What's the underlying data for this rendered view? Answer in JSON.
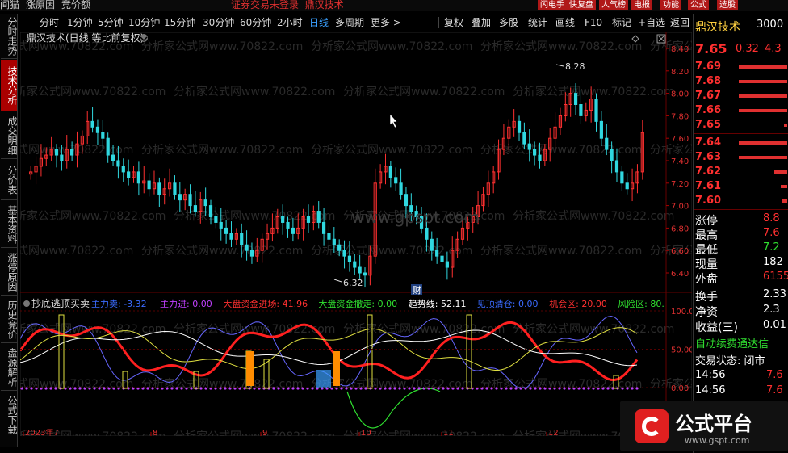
{
  "topbar": {
    "menu": [
      "间猫",
      "涨原因",
      "竞价额"
    ],
    "warning": "证券交易未登录",
    "stock": "鼎汉技术",
    "buttons": [
      "闪电手",
      "快复盘",
      "人气榜",
      "电报",
      "功能",
      "公式",
      "选股"
    ]
  },
  "periodbar": {
    "items": [
      "分时",
      "1分钟",
      "5分钟",
      "10分钟",
      "15分钟",
      "30分钟",
      "60分钟",
      "2小时",
      "日线",
      "多周期",
      "更多 >"
    ],
    "active": "日线",
    "tools": [
      "复权",
      "叠加",
      "多股",
      "统计",
      "画线",
      "F10",
      "标记",
      "+自选",
      "返回"
    ]
  },
  "sidetabs": [
    "分时走势",
    "技术分析",
    "成交明细",
    "分价表",
    "基本资料",
    "涨停原因",
    "历史竞价",
    "盘源解析",
    "公式下载"
  ],
  "chart": {
    "title": "鼎汉技术(日线 等比前复权)",
    "high_label": "8.28",
    "low_label": "6.32",
    "event_label": "财",
    "watermark": "分析家公式网www.70822.com",
    "center_watermark": "www.gpspt.com",
    "y_ticks": [
      "8.40",
      "8.20",
      "8.00",
      "7.80",
      "7.60",
      "7.40",
      "7.20",
      "7.00",
      "6.80",
      "6.60",
      "6.40"
    ],
    "x_labels": [
      "2023年7",
      "8",
      "9",
      "10",
      "11",
      "12"
    ]
  },
  "indicator": {
    "name": "抄底逃顶买卖",
    "items": [
      {
        "label": "主力卖:",
        "value": "-3.32",
        "color": "#3a6bff"
      },
      {
        "label": "主力进:",
        "value": "0.00",
        "color": "#c040ff"
      },
      {
        "label": "大盘资金进场:",
        "value": "41.96",
        "color": "#ff3030"
      },
      {
        "label": "大盘资金撤走:",
        "value": "0.00",
        "color": "#30e030"
      },
      {
        "label": "趋势线:",
        "value": "52.11",
        "color": "#ffffff"
      },
      {
        "label": "见顶清仓:",
        "value": "0.00",
        "color": "#3a6bff"
      },
      {
        "label": "机会区:",
        "value": "20.00",
        "color": "#ff3030"
      },
      {
        "label": "风险区:",
        "value": "80.",
        "color": "#30e030"
      }
    ],
    "y_ticks": [
      "100.00",
      "50.00",
      "0.00"
    ]
  },
  "rightpanel": {
    "stock_name": "鼎汉技术",
    "code": "3000",
    "price": "7.65",
    "change": "0.32",
    "pct": "4.3",
    "asks": [
      {
        "p": "7.69",
        "w": 60
      },
      {
        "p": "7.68",
        "w": 60
      },
      {
        "p": "7.67",
        "w": 60
      },
      {
        "p": "7.66",
        "w": 60
      },
      {
        "p": "7.65",
        "w": 4
      }
    ],
    "bids": [
      {
        "p": "7.64",
        "w": 60
      },
      {
        "p": "7.63",
        "w": 60
      },
      {
        "p": "7.62",
        "w": 16
      },
      {
        "p": "7.61",
        "w": 8
      },
      {
        "p": "7.60",
        "w": 6
      }
    ],
    "stats": [
      {
        "k": "涨停",
        "v": "8.8",
        "c": "#ff3030"
      },
      {
        "k": "最高",
        "v": "7.6",
        "c": "#ff3030"
      },
      {
        "k": "最低",
        "v": "7.2",
        "c": "#30e030"
      },
      {
        "k": "现量",
        "v": "182",
        "c": "#fff"
      },
      {
        "k": "外盘",
        "v": "6155",
        "c": "#ff3030"
      },
      {
        "k": "换手",
        "v": "2.33",
        "c": "#fff"
      },
      {
        "k": "净资",
        "v": "2.3",
        "c": "#fff"
      },
      {
        "k": "收益(三)",
        "v": "0.01",
        "c": "#fff"
      }
    ],
    "auto_fee": "自动续费通达信",
    "trade_status": "交易状态: 闭市",
    "ticks": [
      {
        "t": "14:56",
        "v": "7.6"
      },
      {
        "t": "14:56",
        "v": "7.6"
      }
    ]
  },
  "logo": {
    "text": "公式平台",
    "url": "www.gspt.com"
  },
  "colors": {
    "up": "#ff3030",
    "down": "#30d8e0",
    "bg": "#000000"
  }
}
